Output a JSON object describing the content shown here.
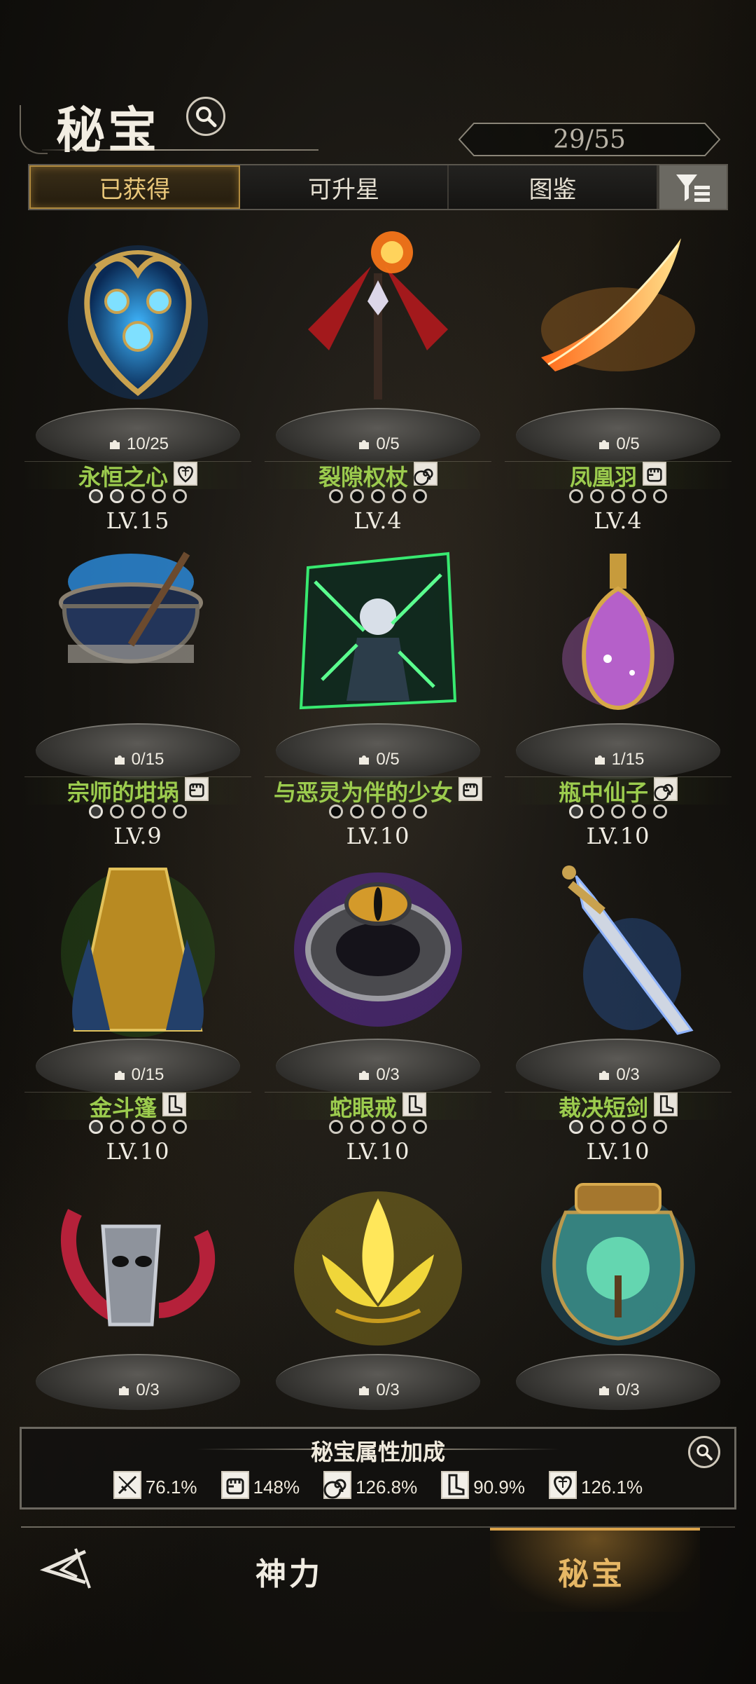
{
  "header": {
    "title": "秘宝",
    "counter": "29/55"
  },
  "tabs": [
    {
      "label": "已获得",
      "active": true
    },
    {
      "label": "可升星",
      "active": false
    },
    {
      "label": "图鉴",
      "active": false
    }
  ],
  "items": [
    {
      "name": "永恒之心",
      "fragments": "10/25",
      "level": "LV.15",
      "type_icon": "heart-icon",
      "stars_filled": 2,
      "art": "mechanical-heart"
    },
    {
      "name": "裂隙权杖",
      "fragments": "0/5",
      "level": "LV.4",
      "type_icon": "swirl-icon",
      "stars_filled": 0,
      "art": "winged-scepter"
    },
    {
      "name": "凤凰羽",
      "fragments": "0/5",
      "level": "LV.4",
      "type_icon": "fist-icon",
      "stars_filled": 0,
      "art": "phoenix-feather"
    },
    {
      "name": "宗师的坩埚",
      "fragments": "0/15",
      "level": "LV.9",
      "type_icon": "fist-icon",
      "stars_filled": 1,
      "art": "cauldron"
    },
    {
      "name": "与恶灵为伴的少女",
      "fragments": "0/5",
      "level": "LV.10",
      "type_icon": "fist-icon",
      "stars_filled": 0,
      "art": "spirit-girl"
    },
    {
      "name": "瓶中仙子",
      "fragments": "1/15",
      "level": "LV.10",
      "type_icon": "swirl-icon",
      "stars_filled": 1,
      "art": "fairy-bottle"
    },
    {
      "name": "金斗篷",
      "fragments": "0/15",
      "level": "LV.10",
      "type_icon": "boot-icon",
      "stars_filled": 1,
      "art": "golden-cloak"
    },
    {
      "name": "蛇眼戒",
      "fragments": "0/3",
      "level": "LV.10",
      "type_icon": "boot-icon",
      "stars_filled": 0,
      "art": "snake-eye-ring"
    },
    {
      "name": "裁决短剑",
      "fragments": "0/3",
      "level": "LV.10",
      "type_icon": "boot-icon",
      "stars_filled": 1,
      "art": "judgment-dagger"
    },
    {
      "name": "",
      "fragments": "0/3",
      "level": "",
      "type_icon": "",
      "stars_filled": 0,
      "art": "horned-mask"
    },
    {
      "name": "",
      "fragments": "0/3",
      "level": "",
      "type_icon": "",
      "stars_filled": 0,
      "art": "golden-lotus"
    },
    {
      "name": "",
      "fragments": "0/3",
      "level": "",
      "type_icon": "",
      "stars_filled": 0,
      "art": "tree-jar"
    }
  ],
  "bonus": {
    "title": "秘宝属性加成",
    "stats": [
      {
        "icon": "sword-icon",
        "value": "76.1%"
      },
      {
        "icon": "fist-icon",
        "value": "148%"
      },
      {
        "icon": "swirl-icon",
        "value": "126.8%"
      },
      {
        "icon": "boot-icon",
        "value": "90.9%"
      },
      {
        "icon": "heart-icon",
        "value": "126.1%"
      }
    ]
  },
  "nav": {
    "left": "神力",
    "right": "秘宝"
  },
  "colors": {
    "accent_gold": "#e9c77a",
    "name_green": "#9ccc4e",
    "panel_border": "#6b6860"
  }
}
